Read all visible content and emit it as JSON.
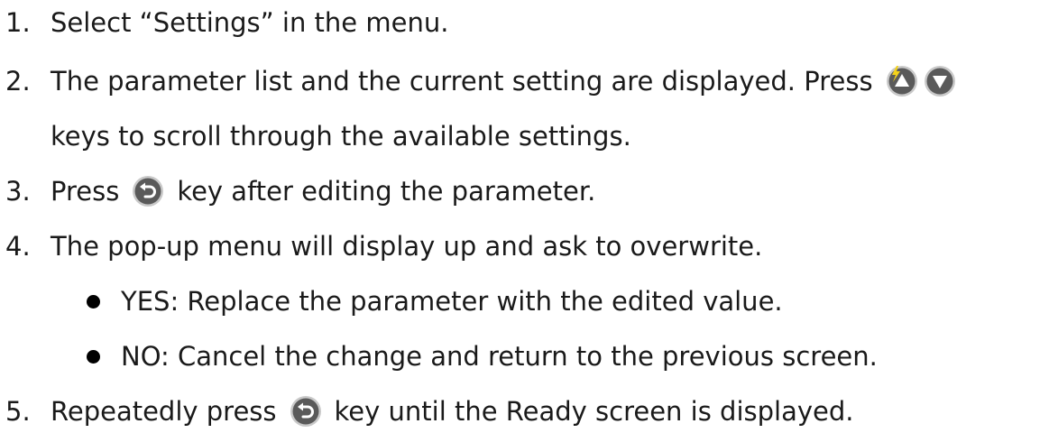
{
  "steps": [
    {
      "num": "1.",
      "text": "Select “Settings” in the menu."
    },
    {
      "num": "2.",
      "text_a": "The parameter list and the current setting are displayed. Press",
      "text_b": "keys to scroll through the available settings."
    },
    {
      "num": "3.",
      "text_a": "Press",
      "text_b": "key after editing the parameter."
    },
    {
      "num": "4.",
      "text": "The pop-up menu will display up and ask to overwrite."
    },
    {
      "num": "5.",
      "text_a": "Repeatedly press",
      "text_b": "key until the Ready screen is displayed."
    }
  ],
  "options": [
    {
      "text": "YES: Replace the parameter with the edited value."
    },
    {
      "text": "NO: Cancel the change and return to the previous screen."
    }
  ],
  "colors": {
    "key_fill": "#5a5a5a",
    "key_ring": "#c9c9c9",
    "flash": "#f4d21a",
    "text": "#1a1a1a"
  },
  "icons": [
    "up-key-icon",
    "down-key-icon",
    "back-key-icon",
    "lightning-icon",
    "bullet-icon"
  ]
}
